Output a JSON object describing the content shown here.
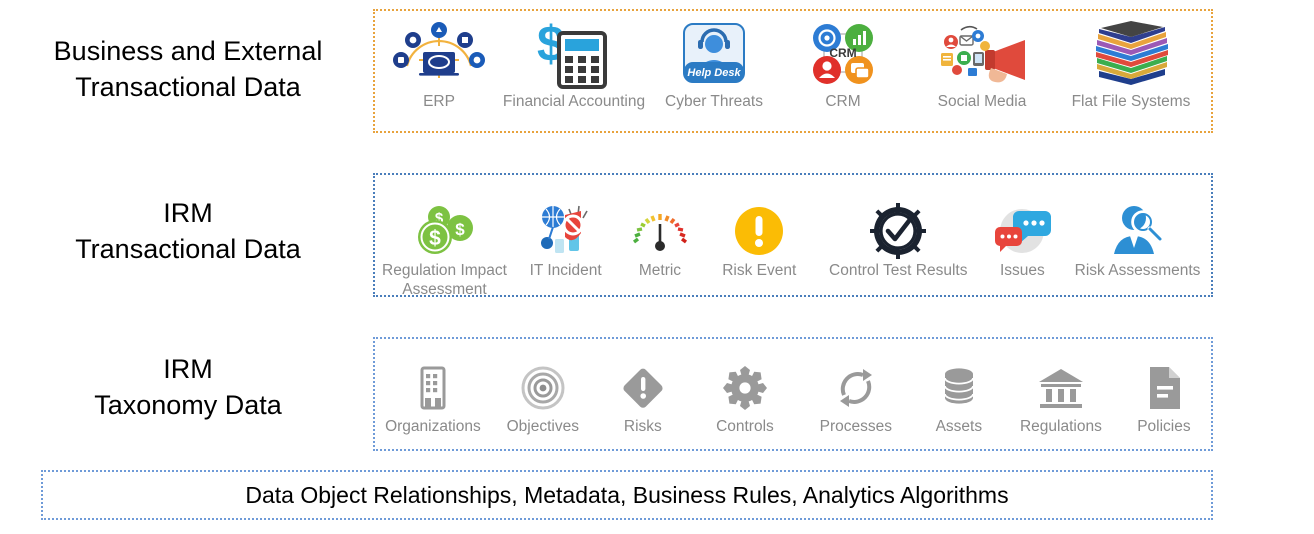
{
  "rows": [
    {
      "label": "Business and External\nTransactional Data",
      "border_color": "#E8A33D",
      "items": [
        {
          "label": "ERP",
          "icon": "erp-network-icon"
        },
        {
          "label": "Financial Accounting",
          "icon": "calculator-dollar-icon"
        },
        {
          "label": "Cyber Threats",
          "icon": "help-desk-agent-icon"
        },
        {
          "label": "CRM",
          "icon": "crm-quadrant-icon"
        },
        {
          "label": "Social Media",
          "icon": "megaphone-social-icon"
        },
        {
          "label": "Flat File Systems",
          "icon": "stacked-files-icon"
        }
      ]
    },
    {
      "label": "IRM\nTransactional Data",
      "border_color": "#4A7EBB",
      "items": [
        {
          "label": "Regulation Impact\nAssessment",
          "icon": "dollar-coins-icon"
        },
        {
          "label": "IT Incident",
          "icon": "shield-block-network-icon"
        },
        {
          "label": "Metric",
          "icon": "gauge-meter-icon"
        },
        {
          "label": "Risk Event",
          "icon": "exclamation-circle-icon"
        },
        {
          "label": "Control Test Results",
          "icon": "gear-checkmark-icon"
        },
        {
          "label": "Issues",
          "icon": "chat-bubbles-icon"
        },
        {
          "label": "Risk Assessments",
          "icon": "person-magnifier-icon"
        }
      ]
    },
    {
      "label": "IRM\nTaxonomy Data",
      "border_color": "#6F9BD8",
      "items": [
        {
          "label": "Organizations",
          "icon": "building-icon"
        },
        {
          "label": "Objectives",
          "icon": "target-rings-icon"
        },
        {
          "label": "Risks",
          "icon": "diamond-exclamation-icon"
        },
        {
          "label": "Controls",
          "icon": "gear-icon"
        },
        {
          "label": "Processes",
          "icon": "refresh-cycle-icon"
        },
        {
          "label": "Assets",
          "icon": "database-stack-icon"
        },
        {
          "label": "Regulations",
          "icon": "bank-columns-icon"
        },
        {
          "label": "Policies",
          "icon": "document-lines-icon"
        }
      ]
    }
  ],
  "footer": {
    "text": "Data Object Relationships, Metadata, Business Rules, Analytics Algorithms",
    "border_color": "#6F9BD8"
  },
  "colors": {
    "row1_border": "#E8A33D",
    "row2_border": "#4A7EBB",
    "row3_border": "#6F9BD8",
    "taxonomy_icon_gray": "#9a9a9a",
    "item_label_gray": "#8a8a8a",
    "heading_black": "#000000"
  }
}
